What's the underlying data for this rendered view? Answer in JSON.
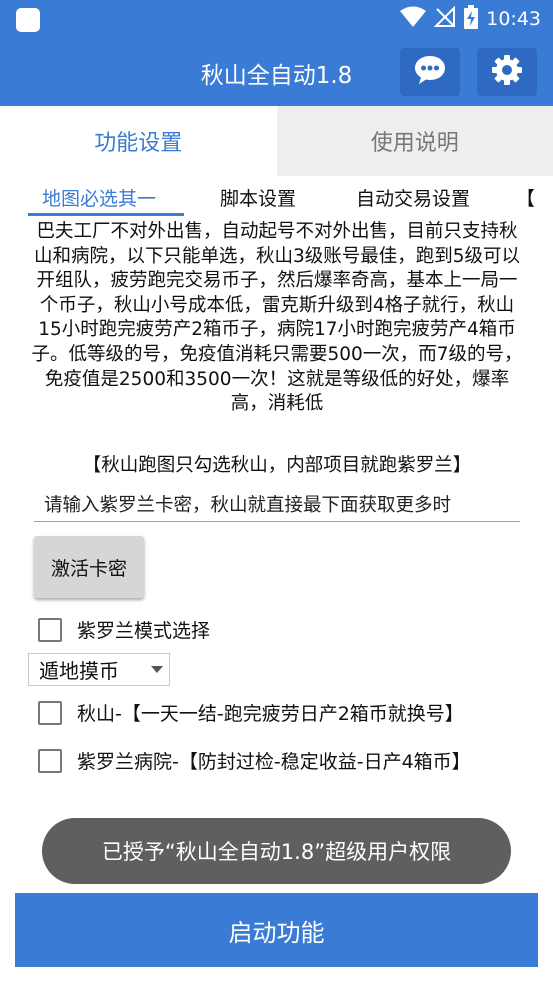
{
  "status_bar": {
    "time": "10:43",
    "icons": [
      "app-icon",
      "wifi-icon",
      "no-signal-icon",
      "battery-charging-icon"
    ]
  },
  "app_bar": {
    "title": "秋山全自动1.8",
    "actions": [
      "chat-icon",
      "gear-icon"
    ]
  },
  "main_tabs": [
    {
      "label": "功能设置",
      "active": true
    },
    {
      "label": "使用说明",
      "active": false
    }
  ],
  "sub_tabs": [
    {
      "label": "地图必选其一",
      "active": true
    },
    {
      "label": "脚本设置",
      "active": false
    },
    {
      "label": "自动交易设置",
      "active": false
    },
    {
      "label": "【",
      "active": false
    }
  ],
  "description": "巴夫工厂不对外出售，自动起号不对外出售，目前只支持秋山和病院，以下只能单选，秋山3级账号最佳，跑到5级可以开组队，疲劳跑完交易币子，然后爆率奇高，基本上一局一个币子，秋山小号成本低，雷克斯升级到4格子就行，秋山15小时跑完疲劳产2箱币子，病院17小时跑完疲劳产4箱币子。低等级的号，免疫值消耗只需要500一次，而7级的号，免疫值是2500和3500一次！这就是等级低的好处，爆率高，消耗低",
  "note": "【秋山跑图只勾选秋山，内部项目就跑紫罗兰】",
  "key_input": {
    "value": "请输入紫罗兰卡密，秋山就直接最下面获取更多时",
    "placeholder": ""
  },
  "activate_button": "激活卡密",
  "options": {
    "violet_mode": {
      "label": "紫罗兰模式选择",
      "checked": false
    },
    "map_select": {
      "selected": "遁地摸币"
    },
    "qiushan": {
      "label": "秋山-【一天一结-跑完疲劳日产2箱币就换号】",
      "checked": false
    },
    "violet_hospital": {
      "label": "紫罗兰病院-【防封过检-稳定收益-日产4箱币】",
      "checked": false
    }
  },
  "toast": "已授予“秋山全自动1.8”超级用户权限",
  "start_button": "启动功能",
  "colors": {
    "primary": "#3a7bd5",
    "primary_dark": "#2f6ac2",
    "toast_bg": "#5f5f5f",
    "inactive_tab_bg": "#eeeeee"
  }
}
